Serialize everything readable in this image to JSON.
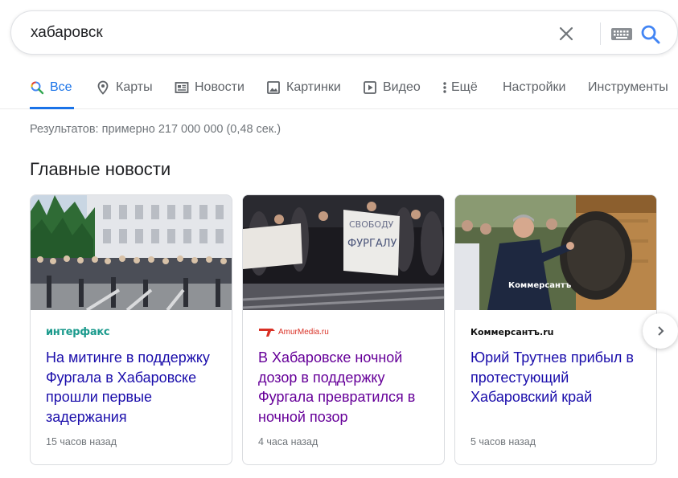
{
  "search": {
    "query": "хабаровск"
  },
  "tabs": [
    {
      "label": "Все",
      "icon": "search-icon",
      "active": true
    },
    {
      "label": "Карты",
      "icon": "map-pin-icon"
    },
    {
      "label": "Новости",
      "icon": "news-icon"
    },
    {
      "label": "Картинки",
      "icon": "image-icon"
    },
    {
      "label": "Видео",
      "icon": "video-icon"
    },
    {
      "label": "Ещё",
      "icon": "more-vert-icon"
    },
    {
      "label": "Настройки"
    },
    {
      "label": "Инструменты"
    }
  ],
  "result_stats": "Результатов: примерно 217 000 000 (0,48 сек.)",
  "section_title": "Главные новости",
  "news": [
    {
      "source": "интерфакс",
      "headline": "На митинге в поддержку Фургала в Хабаровске прошли первые задержания",
      "time": "15 часов назад",
      "visited": false
    },
    {
      "source": "AmurMedia.ru",
      "headline": "В Хабаровске ночной дозор в поддержку Фургала превратился в ночной позор",
      "time": "4 часа назад",
      "visited": true
    },
    {
      "source": "Коммерсантъ.ru",
      "headline": "Юрий Трутнев прибыл в протестующий Хабаровский край",
      "time": "5 часов назад",
      "visited": false
    }
  ],
  "image_texts": {
    "sign_line1": "СВОБОДУ",
    "sign_line2": "ФУРГАЛУ",
    "watermark": "Коммерсантъ"
  },
  "colors": {
    "accent": "#1a73e8",
    "link": "#1a0dab",
    "visited": "#660099",
    "interfax": "#1a9a8c",
    "amurmedia": "#d93025"
  }
}
